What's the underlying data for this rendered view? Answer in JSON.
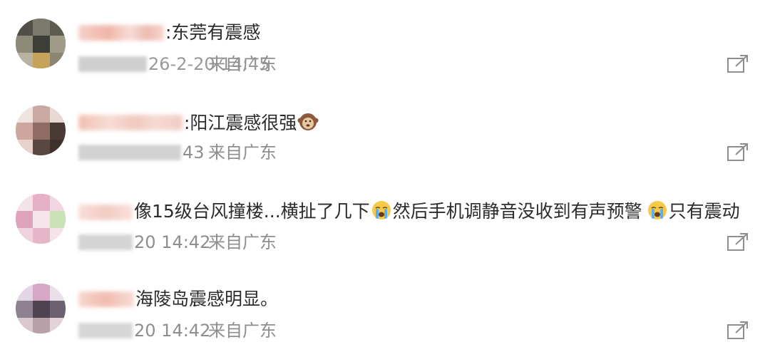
{
  "comments": [
    {
      "text": ":东莞有震感",
      "time_partial": "26-2-20 14:45",
      "location": "来自广东",
      "share_icon": "share-icon"
    },
    {
      "text": ":阳江震感很强",
      "emoji": "see-no-evil-monkey-icon",
      "time_partial": "43",
      "location": "来自广东",
      "share_icon": "share-icon"
    },
    {
      "text_parts": [
        "像15级台风撞楼...横扯了几下",
        "然后手机调静音没收到有声预警",
        "只有震动"
      ],
      "emoji": "crying-face-icon",
      "time_partial": "20 14:42",
      "location": "来自广东",
      "share_icon": "share-icon"
    },
    {
      "text": "海陵岛震感明显。",
      "time_partial": "20 14:42",
      "location": "来自广东",
      "share_icon": "share-icon"
    }
  ]
}
